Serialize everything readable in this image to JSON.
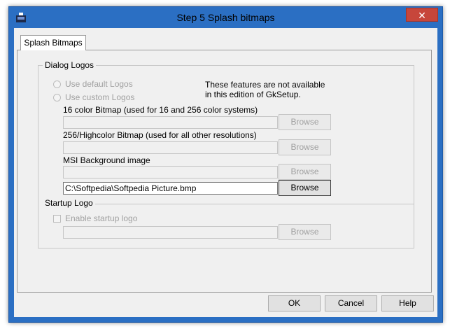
{
  "window": {
    "title": "Step 5 Splash bitmaps",
    "close_glyph": "✕"
  },
  "tabs": [
    {
      "label": "Splash Bitmaps",
      "selected": true
    }
  ],
  "dialog_logos": {
    "legend": "Dialog Logos",
    "radio_default": "Use default Logos",
    "radio_custom": "Use custom Logos",
    "notice_line1": "These features are not available",
    "notice_line2": "in this edition of GkSetup.",
    "bitmap16_label": "16 color Bitmap (used for 16 and 256 color systems)",
    "bitmap16_value": "",
    "highcolor_label": "256/Highcolor Bitmap (used for all other resolutions)",
    "highcolor_value": "",
    "msi_label": "MSI Background image",
    "msi_value": "",
    "picture_value": "C:\\Softpedia\\Softpedia Picture.bmp",
    "browse_label": "Browse"
  },
  "startup_logo": {
    "legend": "Startup Logo",
    "checkbox_label": "Enable startup logo",
    "path_value": "",
    "browse_label": "Browse"
  },
  "footer": {
    "ok_label": "OK",
    "cancel_label": "Cancel",
    "help_label": "Help"
  }
}
